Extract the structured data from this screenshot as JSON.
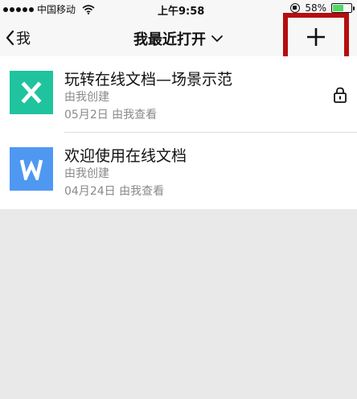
{
  "status_bar": {
    "carrier": "中国移动",
    "time": "上午9:58",
    "battery": "58%",
    "battery_level": 0.58
  },
  "nav": {
    "back_label": "我",
    "title": "我最近打开",
    "add_symbol": "+"
  },
  "documents": [
    {
      "icon_letter": "X",
      "icon_color": "#1fc49e",
      "title": "玩转在线文档—场景示范",
      "creator": "由我创建",
      "viewed": "05月2日 由我查看",
      "locked": true
    },
    {
      "icon_letter": "W",
      "icon_color": "#4f98f2",
      "title": "欢迎使用在线文档",
      "creator": "由我创建",
      "viewed": "04月24日 由我查看",
      "locked": false
    }
  ]
}
